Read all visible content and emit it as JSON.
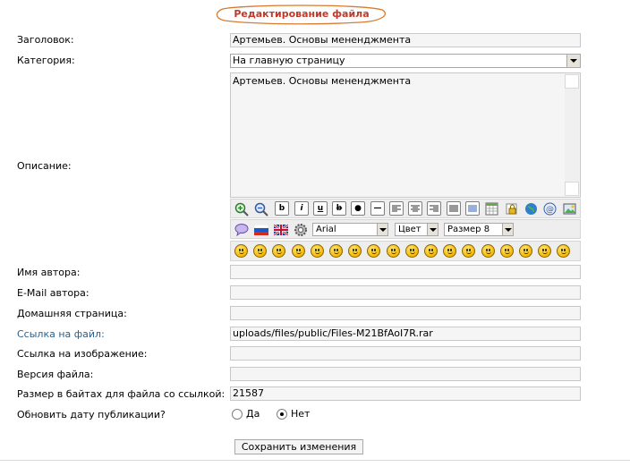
{
  "page": {
    "title": "Редактирование файла"
  },
  "form": {
    "title_label": "Заголовок:",
    "title_value": "Артемьев. Основы мененджмента",
    "category_label": "Категория:",
    "category_value": "На главную страницу",
    "description_label": "Описание:",
    "description_value": "Артемьев. Основы мененджмента",
    "author_label": "Имя автора:",
    "author_value": "",
    "author_email_label": "E-Mail автора:",
    "author_email_value": "",
    "homepage_label": "Домашняя страница:",
    "homepage_value": "",
    "file_link_label": "Ссылка на файл:",
    "file_link_value": "uploads/files/public/Files-M21BfAoI7R.rar",
    "image_link_label": "Ссылка на изображение:",
    "image_link_value": "",
    "version_label": "Версия файла:",
    "version_value": "",
    "size_label": "Размер в байтах для файла со ссылкой:",
    "size_value": "21587",
    "update_date_label": "Обновить дату публикации?",
    "radio_yes": "Да",
    "radio_no": "Нет",
    "update_date_selected": "Нет",
    "submit_label": "Сохранить изменения"
  },
  "editor": {
    "toolbar1": [
      {
        "name": "zoom-in-icon"
      },
      {
        "name": "zoom-out-icon"
      },
      {
        "name": "bold-button",
        "glyph": "b"
      },
      {
        "name": "italic-button",
        "glyph": "i"
      },
      {
        "name": "underline-button",
        "glyph": "u"
      },
      {
        "name": "strike-button",
        "glyph": "b"
      },
      {
        "name": "bullet-button",
        "glyph": "●"
      },
      {
        "name": "hr-button",
        "glyph": "—"
      },
      {
        "name": "align-left-button"
      },
      {
        "name": "align-center-button"
      },
      {
        "name": "align-right-button"
      },
      {
        "name": "justify-button"
      },
      {
        "name": "list-button"
      },
      {
        "name": "table-icon"
      },
      {
        "name": "lock-icon"
      },
      {
        "name": "globe-icon"
      },
      {
        "name": "email-icon"
      },
      {
        "name": "image-icon"
      }
    ],
    "font_value": "Arial",
    "color_value": "Цвет",
    "size_value": "Размер 8",
    "smiley_count": 19,
    "colors": {
      "title": "#c0392b",
      "link_label": "#2a5f8a",
      "field_bg": "#f5f5f5"
    }
  }
}
